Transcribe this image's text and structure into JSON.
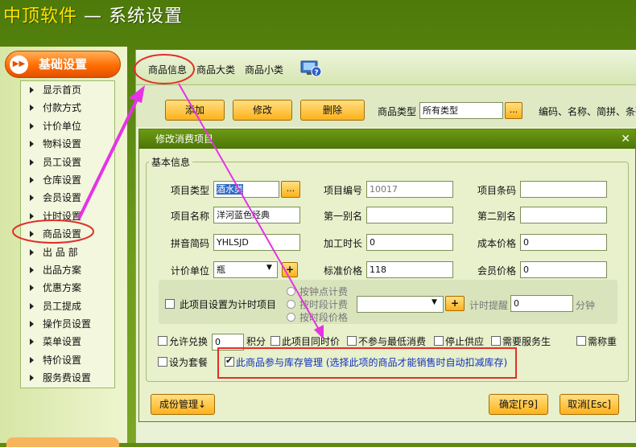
{
  "app": {
    "brand": "中顶软件",
    "title_suffix": " — 系统设置"
  },
  "sidebar": {
    "header": "基础设置",
    "header_icon": "double-chevron-icon",
    "items": [
      "显示首页",
      "付款方式",
      "计价单位",
      "物料设置",
      "员工设置",
      "仓库设置",
      "会员设置",
      "计时设置",
      "商品设置",
      "出 品 部",
      "出品方案",
      "优惠方案",
      "员工提成",
      "操作员设置",
      "菜单设置",
      "特价设置",
      "服务费设置"
    ]
  },
  "tabs": [
    "商品信息",
    "商品大类",
    "商品小类"
  ],
  "toolbar": {
    "add": "添加",
    "edit": "修改",
    "delete": "删除",
    "type_label": "商品类型",
    "type_value": "所有类型",
    "dots": "...",
    "search_hint": "编码、名称、简拼、条码"
  },
  "dialog": {
    "title": "修改消费项目",
    "close": "✕",
    "group_title": "基本信息",
    "fields": {
      "item_type_label": "项目类型",
      "item_type_value": "酒水类",
      "item_no_label": "项目编号",
      "item_no_value": "10017",
      "barcode_label": "项目条码",
      "barcode_value": "",
      "name_label": "项目名称",
      "name_value": "洋河蓝色经典",
      "alias1_label": "第一别名",
      "alias1_value": "",
      "alias2_label": "第二别名",
      "alias2_value": "",
      "pinyin_label": "拼音简码",
      "pinyin_value": "YHLSJD",
      "proc_label": "加工时长",
      "proc_value": "0",
      "cost_label": "成本价格",
      "cost_value": "0",
      "unit_label": "计价单位",
      "unit_value": "瓶",
      "std_price_label": "标准价格",
      "std_price_value": "118",
      "member_price_label": "会员价格",
      "member_price_value": "0"
    },
    "timer": {
      "check_label": "此项目设置为计时项目",
      "radio1": "按钟点计费",
      "radio2": "按时段计费",
      "radio3": "按时段价格",
      "remind_label": "计时提醒",
      "remind_value": "0",
      "minutes": "分钟"
    },
    "options": {
      "exchange_label": "允许兑换",
      "points_value": "0",
      "points_unit": "积分",
      "same_price": "此项目同时价",
      "no_min": "不参与最低消费",
      "stop": "停止供应",
      "need_service": "需要服务生",
      "need_weigh": "需称重",
      "set_meal": "设为套餐",
      "inventory": "此商品参与库存管理 (选择此项的商品才能销售时自动扣减库存)"
    },
    "buttons": {
      "cost_mgmt": "成份管理↓",
      "ok": "确定[F9]",
      "cancel": "取消[Esc]"
    }
  },
  "colors": {
    "accent_orange": "#ff6d00",
    "annotation_magenta": "#e533e5",
    "highlight_red": "#e0302a",
    "title_bar_green": "#5a8510"
  }
}
